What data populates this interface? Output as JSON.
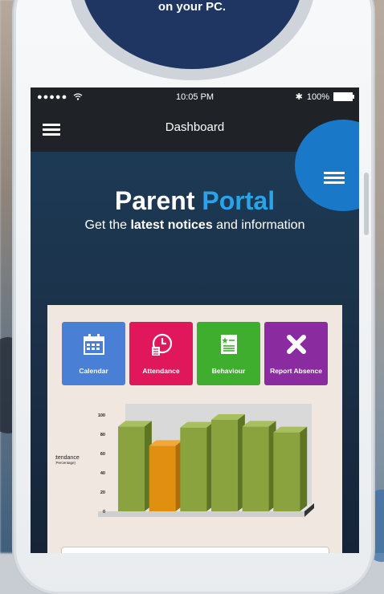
{
  "promo": {
    "text": "on your PC."
  },
  "status_bar": {
    "signal": "●●●●●",
    "time": "10:05 PM",
    "bluetooth": "✱",
    "battery": "100%"
  },
  "navbar": {
    "title": "Dashboard",
    "menu_icon": "hamburger-icon"
  },
  "corner_menu": {
    "icon": "hamburger-icon"
  },
  "hero": {
    "title_part1": "Parent",
    "title_part2": "Portal",
    "subtitle_pre": "Get the",
    "subtitle_bold": "latest notices",
    "subtitle_post": "and information"
  },
  "tiles": [
    {
      "label": "Calendar",
      "icon": "calendar-icon",
      "color": "#4a7fd6"
    },
    {
      "label": "Attendance",
      "icon": "clock-document-icon",
      "color": "#e0175a"
    },
    {
      "label": "Behaviour",
      "icon": "star-document-icon",
      "color": "#3fae2f"
    },
    {
      "label": "Report Absence",
      "icon": "x-icon",
      "color": "#8a2ca0"
    }
  ],
  "chart_data": {
    "type": "bar",
    "ylabel": "Attendance",
    "ylabel_sub": "(Percentage)",
    "ylim": [
      0,
      100
    ],
    "yticks": [
      0,
      20,
      40,
      60,
      80,
      100
    ],
    "values": [
      88,
      68,
      87,
      95,
      88,
      82
    ],
    "bar_colors": [
      "#8aa33f",
      "#e08f10",
      "#8aa33f",
      "#8aa33f",
      "#8aa33f",
      "#8aa33f"
    ],
    "grid": false
  }
}
